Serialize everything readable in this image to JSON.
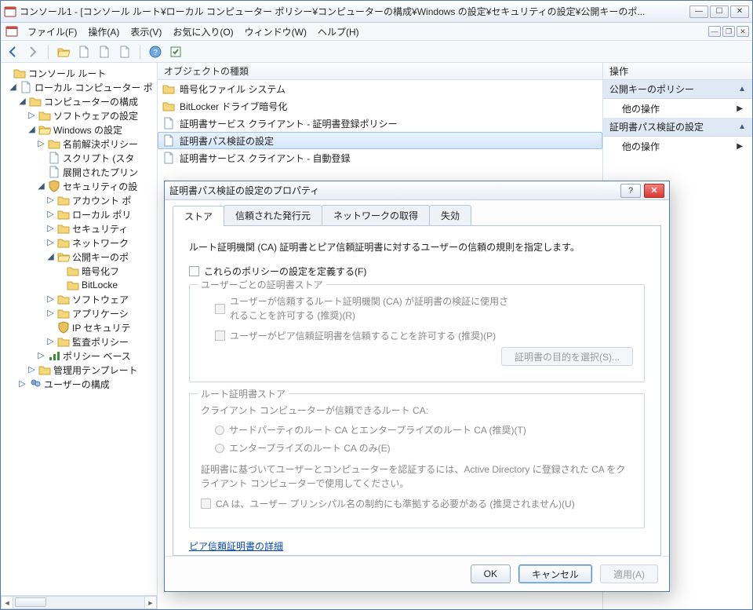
{
  "window": {
    "title": "コンソール1 - [コンソール ルート¥ローカル コンピューター ポリシー¥コンピューターの構成¥Windows の設定¥セキュリティの設定¥公開キーのポ..."
  },
  "menu": {
    "file": "ファイル(F)",
    "action": "操作(A)",
    "view": "表示(V)",
    "favorites": "お気に入り(O)",
    "window": "ウィンドウ(W)",
    "help": "ヘルプ(H)"
  },
  "tree": {
    "root": "コンソール ルート",
    "lcp": "ローカル コンピューター ポ",
    "comp_cfg": "コンピューターの構成",
    "sw_settings": "ソフトウェアの設定",
    "win_settings": "Windows の設定",
    "namres": "名前解決ポリシー",
    "scripts": "スクリプト (スタ",
    "deployed": "展開されたプリン",
    "sec_settings": "セキュリティの設",
    "account": "アカウント ポ",
    "local_pol": "ローカル ポリ",
    "sec_opts": "セキュリティ",
    "network": "ネットワーク",
    "pubkey": "公開キーのポ",
    "efs": "暗号化フ",
    "bitlocker": "BitLocke",
    "swres": "ソフトウェア",
    "appctl": "アプリケーシ",
    "ipsec": "IP セキュリテ",
    "audit": "監査ポリシー",
    "policy_base": "ポリシー ベース",
    "admin_tmpl": "管理用テンプレート",
    "user_cfg": "ユーザーの構成"
  },
  "list": {
    "header": "オブジェクトの種類",
    "items": [
      "暗号化ファイル システム",
      "BitLocker ドライブ暗号化",
      "証明書サービス クライアント - 証明書登録ポリシー",
      "証明書パス検証の設定",
      "証明書サービス クライアント - 自動登録"
    ]
  },
  "actions": {
    "title": "操作",
    "section1": "公開キーのポリシー",
    "item1": "他の操作",
    "section2": "証明書パス検証の設定",
    "item2": "他の操作"
  },
  "dialog": {
    "title": "証明書パス検証の設定のプロパティ",
    "tabs": {
      "store": "ストア",
      "trusted": "信頼された発行元",
      "netret": "ネットワークの取得",
      "revoc": "失効"
    },
    "desc": "ルート証明機関 (CA) 証明書とピア信頼証明書に対するユーザーの信頼の規則を指定します。",
    "define": "これらのポリシーの設定を定義する(F)",
    "user_store_legend": "ユーザーごとの証明書ストア",
    "allow_root": "ユーザーが信頼するルート証明機関 (CA) が証明書の検証に使用されることを許可する (推奨)(R)",
    "allow_peer": "ユーザーがピア信頼証明書を信頼することを許可する (推奨)(P)",
    "purpose_btn": "証明書の目的を選択(S)...",
    "root_store_legend": "ルート証明書ストア",
    "root_store_note": "クライアント コンピューターが信頼できるルート CA:",
    "radio1": "サードパーティのルート CA とエンタープライズのルート CA (推奨)(T)",
    "radio2": "エンタープライズのルート CA のみ(E)",
    "ad_note": "証明書に基づいてユーザーとコンピューターを認証するには、Active Directory に登録された CA をクライアント コンピューターで使用してください。",
    "upn": "CA は、ユーザー プリンシパル名の制約にも準拠する必要がある (推奨されません)(U)",
    "peer_link": "ピア信頼証明書の詳細",
    "ok": "OK",
    "cancel": "キャンセル",
    "apply": "適用(A)"
  }
}
